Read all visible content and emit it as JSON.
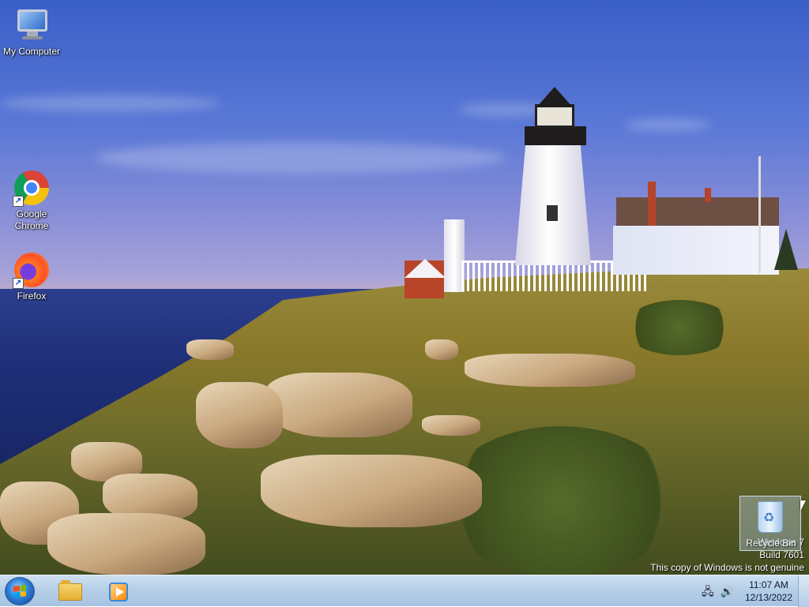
{
  "desktop": {
    "icons": [
      {
        "label": "My Computer",
        "icon": "computer-icon"
      },
      {
        "label": "Google\nChrome",
        "label_line1": "Google",
        "label_line2": "Chrome",
        "icon": "chrome-icon"
      },
      {
        "label": "Firefox",
        "icon": "firefox-icon"
      }
    ],
    "recycle_bin": {
      "label": "Recycle Bin",
      "icon": "recycle-bin-icon"
    },
    "watermark": {
      "line1": "Windows 7",
      "line2": "Build 7601",
      "line3": "This copy of Windows is not genuine"
    }
  },
  "taskbar": {
    "start_icon": "windows-start-icon",
    "pinned": [
      {
        "name": "Windows Explorer",
        "icon": "folder-icon"
      },
      {
        "name": "Windows Media Player",
        "icon": "media-player-icon"
      }
    ],
    "tray": {
      "network_icon": "network-icon",
      "volume_icon": "volume-icon"
    },
    "clock": {
      "time": "11:07 AM",
      "date": "12/13/2022"
    }
  },
  "colors": {
    "taskbar": "#b6cfe7",
    "sky": "#3a5fc8",
    "sea": "#1f2f78"
  }
}
